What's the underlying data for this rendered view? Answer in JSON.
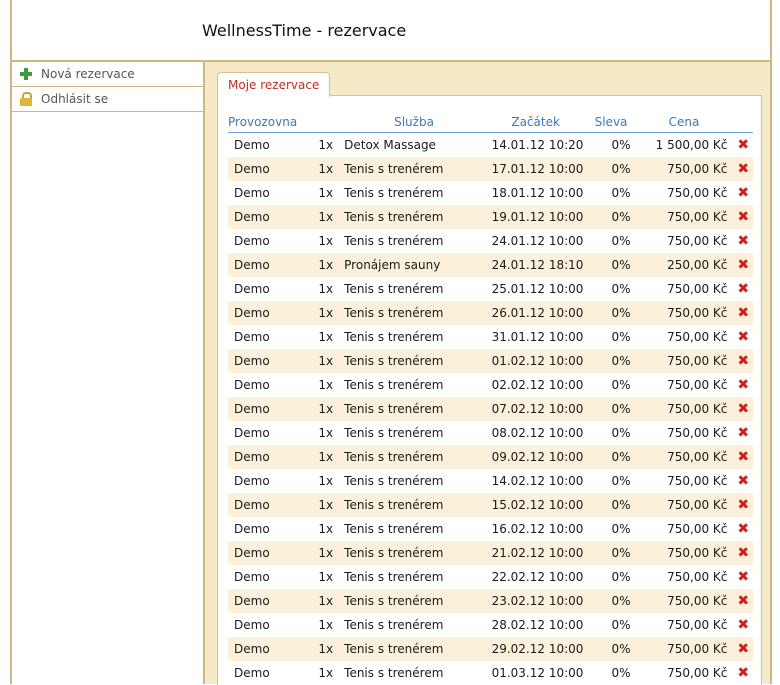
{
  "app": {
    "title": "WellnessTime - rezervace"
  },
  "sidebar": {
    "items": [
      {
        "label": "Nová rezervace",
        "icon": "plus-icon"
      },
      {
        "label": "Odhlásit se",
        "icon": "lock-icon"
      }
    ]
  },
  "tab": {
    "label": "Moje rezervace"
  },
  "table": {
    "headers": [
      "Provozovna",
      "Služba",
      "Začátek",
      "Sleva",
      "Cena"
    ],
    "rows": [
      [
        "Demo",
        "1x",
        "Detox Massage",
        "14.01.12 10:20",
        "0%",
        "1 500,00 Kč"
      ],
      [
        "Demo",
        "1x",
        "Tenis s trenérem",
        "17.01.12 10:00",
        "0%",
        "750,00 Kč"
      ],
      [
        "Demo",
        "1x",
        "Tenis s trenérem",
        "18.01.12 10:00",
        "0%",
        "750,00 Kč"
      ],
      [
        "Demo",
        "1x",
        "Tenis s trenérem",
        "19.01.12 10:00",
        "0%",
        "750,00 Kč"
      ],
      [
        "Demo",
        "1x",
        "Tenis s trenérem",
        "24.01.12 10:00",
        "0%",
        "750,00 Kč"
      ],
      [
        "Demo",
        "1x",
        "Pronájem sauny",
        "24.01.12 18:10",
        "0%",
        "250,00 Kč"
      ],
      [
        "Demo",
        "1x",
        "Tenis s trenérem",
        "25.01.12 10:00",
        "0%",
        "750,00 Kč"
      ],
      [
        "Demo",
        "1x",
        "Tenis s trenérem",
        "26.01.12 10:00",
        "0%",
        "750,00 Kč"
      ],
      [
        "Demo",
        "1x",
        "Tenis s trenérem",
        "31.01.12 10:00",
        "0%",
        "750,00 Kč"
      ],
      [
        "Demo",
        "1x",
        "Tenis s trenérem",
        "01.02.12 10:00",
        "0%",
        "750,00 Kč"
      ],
      [
        "Demo",
        "1x",
        "Tenis s trenérem",
        "02.02.12 10:00",
        "0%",
        "750,00 Kč"
      ],
      [
        "Demo",
        "1x",
        "Tenis s trenérem",
        "07.02.12 10:00",
        "0%",
        "750,00 Kč"
      ],
      [
        "Demo",
        "1x",
        "Tenis s trenérem",
        "08.02.12 10:00",
        "0%",
        "750,00 Kč"
      ],
      [
        "Demo",
        "1x",
        "Tenis s trenérem",
        "09.02.12 10:00",
        "0%",
        "750,00 Kč"
      ],
      [
        "Demo",
        "1x",
        "Tenis s trenérem",
        "14.02.12 10:00",
        "0%",
        "750,00 Kč"
      ],
      [
        "Demo",
        "1x",
        "Tenis s trenérem",
        "15.02.12 10:00",
        "0%",
        "750,00 Kč"
      ],
      [
        "Demo",
        "1x",
        "Tenis s trenérem",
        "16.02.12 10:00",
        "0%",
        "750,00 Kč"
      ],
      [
        "Demo",
        "1x",
        "Tenis s trenérem",
        "21.02.12 10:00",
        "0%",
        "750,00 Kč"
      ],
      [
        "Demo",
        "1x",
        "Tenis s trenérem",
        "22.02.12 10:00",
        "0%",
        "750,00 Kč"
      ],
      [
        "Demo",
        "1x",
        "Tenis s trenérem",
        "23.02.12 10:00",
        "0%",
        "750,00 Kč"
      ],
      [
        "Demo",
        "1x",
        "Tenis s trenérem",
        "28.02.12 10:00",
        "0%",
        "750,00 Kč"
      ],
      [
        "Demo",
        "1x",
        "Tenis s trenérem",
        "29.02.12 10:00",
        "0%",
        "750,00 Kč"
      ],
      [
        "Demo",
        "1x",
        "Tenis s trenérem",
        "01.03.12 10:00",
        "0%",
        "750,00 Kč"
      ]
    ],
    "delete_glyph": "✖"
  },
  "colors": {
    "frame": "#cdb787",
    "accent_tab": "#c0301f",
    "header_text": "#3a7abf",
    "delete": "#d02020"
  }
}
